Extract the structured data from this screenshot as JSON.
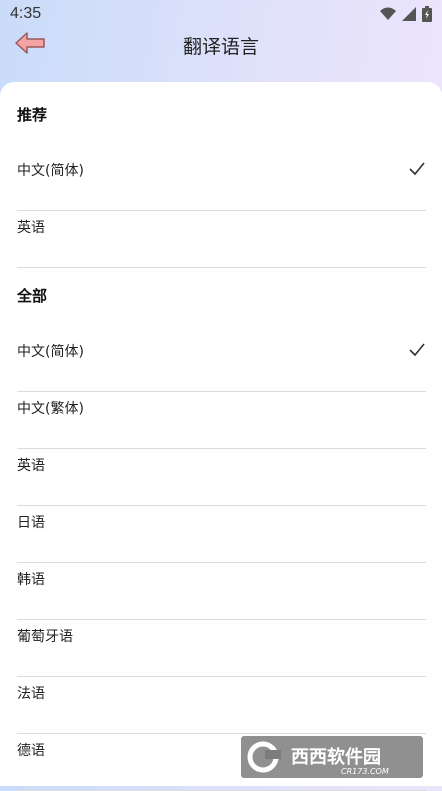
{
  "status": {
    "time": "4:35"
  },
  "header": {
    "title": "翻译语言"
  },
  "recommended": {
    "title": "推荐",
    "items": [
      {
        "label": "中文(简体)",
        "selected": true
      },
      {
        "label": "英语",
        "selected": false
      }
    ]
  },
  "all": {
    "title": "全部",
    "items": [
      {
        "label": "中文(简体)",
        "selected": true
      },
      {
        "label": "中文(繁体)",
        "selected": false
      },
      {
        "label": "英语",
        "selected": false
      },
      {
        "label": "日语",
        "selected": false
      },
      {
        "label": "韩语",
        "selected": false
      },
      {
        "label": "葡萄牙语",
        "selected": false
      },
      {
        "label": "法语",
        "selected": false
      },
      {
        "label": "德语",
        "selected": false
      }
    ]
  },
  "watermark": {
    "brand": "西西软件园",
    "domain": "CR173.COM"
  },
  "colors": {
    "accent_back": "#f08a8a",
    "divider": "#dcdcdc"
  }
}
